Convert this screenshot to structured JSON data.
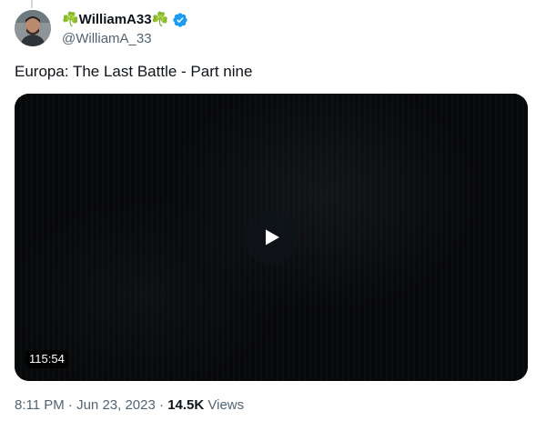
{
  "tweet": {
    "author": {
      "display_name": "☘️WilliamA33☘️",
      "handle": "@WilliamA_33",
      "verified": true,
      "verified_color": "#1d9bf0"
    },
    "text": "Europa: The Last Battle - Part nine",
    "video": {
      "duration": "115:54",
      "play_icon": "play-icon"
    },
    "meta": {
      "time": "8:11 PM",
      "separator": "·",
      "date": "Jun 23, 2023",
      "views_count": "14.5K",
      "views_label": "Views"
    }
  },
  "colors": {
    "text_primary": "#0f1419",
    "text_secondary": "#536471",
    "accent": "#1d9bf0"
  }
}
